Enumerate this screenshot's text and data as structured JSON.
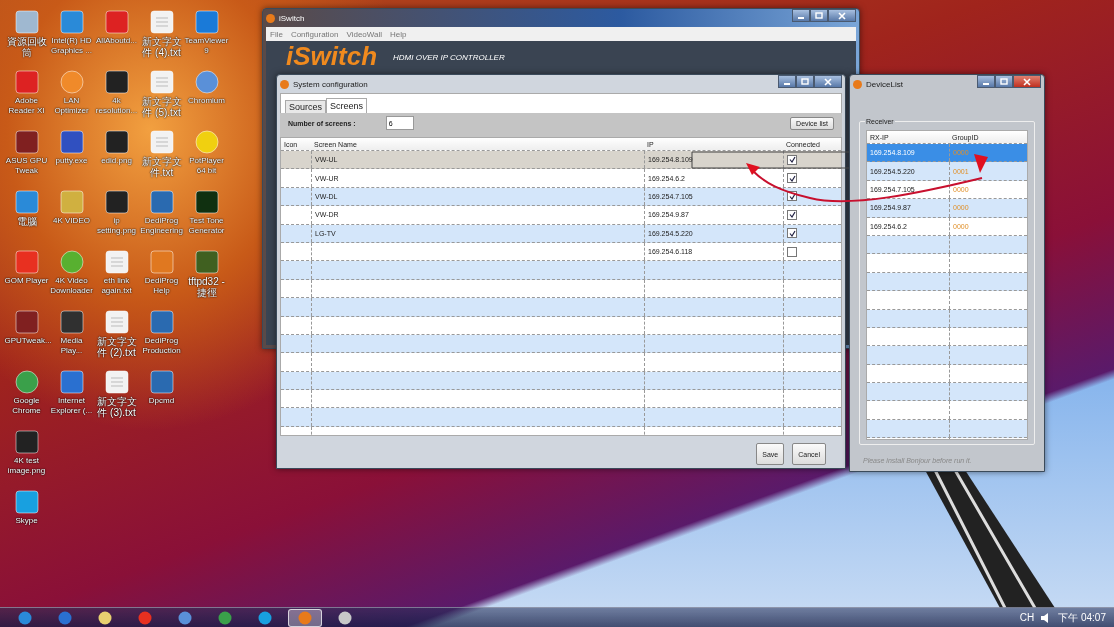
{
  "desktop": {
    "rows": [
      [
        {
          "label": "資源回收筒",
          "kind": "bin"
        },
        {
          "label": "Intel(R) HD Graphics ...",
          "kind": "monitor"
        },
        {
          "label": "AllAboutd...",
          "kind": "pdf"
        },
        {
          "label": "新文字文件 (4).txt",
          "kind": "doc"
        },
        {
          "label": "TeamViewer 9",
          "kind": "teamviewer"
        }
      ],
      [
        {
          "label": "Adobe Reader XI",
          "kind": "pdf"
        },
        {
          "label": "LAN Optimizer",
          "kind": "ring"
        },
        {
          "label": "4k resolution...",
          "kind": "image"
        },
        {
          "label": "新文字文件 (5).txt",
          "kind": "doc"
        },
        {
          "label": "Chromium",
          "kind": "chromium"
        }
      ],
      [
        {
          "label": "ASUS GPU Tweak",
          "kind": "gpu"
        },
        {
          "label": "putty.exe",
          "kind": "putty"
        },
        {
          "label": "edid.png",
          "kind": "image"
        },
        {
          "label": "新文字文件.txt",
          "kind": "doc"
        },
        {
          "label": "PotPlayer 64 bit",
          "kind": "player"
        }
      ],
      [
        {
          "label": "電腦",
          "kind": "monitor"
        },
        {
          "label": "4K VIDEO",
          "kind": "folder"
        },
        {
          "label": "ip setting.png",
          "kind": "image"
        },
        {
          "label": "DediProg Engineering",
          "kind": "dediprog"
        },
        {
          "label": "Test Tone Generator",
          "kind": "wave"
        }
      ],
      [
        {
          "label": "GOM Player",
          "kind": "gom"
        },
        {
          "label": "4K Video Downloader",
          "kind": "download"
        },
        {
          "label": "eth link again.txt",
          "kind": "doc"
        },
        {
          "label": "DediProg Help",
          "kind": "help"
        },
        {
          "label": "tftpd32 - 捷徑",
          "kind": "tftp"
        }
      ],
      [
        {
          "label": "GPUTweak...",
          "kind": "gpu"
        },
        {
          "label": "Media Play...",
          "kind": "media"
        },
        {
          "label": "新文字文件 (2).txt",
          "kind": "doc"
        },
        {
          "label": "DediProg Production",
          "kind": "dediprog"
        }
      ],
      [
        {
          "label": "Google Chrome",
          "kind": "chrome"
        },
        {
          "label": "Internet Explorer (...",
          "kind": "ie"
        },
        {
          "label": "新文字文件 (3).txt",
          "kind": "doc"
        },
        {
          "label": "Dpcmd",
          "kind": "dediprog"
        }
      ],
      [
        {
          "label": "4K test image.png",
          "kind": "image"
        }
      ],
      [
        {
          "label": "Skype",
          "kind": "skype"
        }
      ]
    ]
  },
  "main_window": {
    "title": "iSwitch",
    "menu": [
      "File",
      "Configuration",
      "VideoWall",
      "Help"
    ],
    "logo": "iSwitch",
    "subtitle": "HDMI OVER IP CONTROLLER"
  },
  "config_window": {
    "title": "System configuration",
    "tabs": [
      {
        "label": "Sources",
        "selected": false
      },
      {
        "label": "Screens",
        "selected": true
      }
    ],
    "screens_label": "Number of screens :",
    "screens_value": "6",
    "device_list_button": "Device list",
    "columns": [
      "Icon",
      "Screen Name",
      "IP",
      "Connected"
    ],
    "rows": [
      {
        "name": "VW-UL",
        "ip": "169.254.8.109",
        "checked": true,
        "selected": true
      },
      {
        "name": "VW-UR",
        "ip": "169.254.6.2",
        "checked": true,
        "selected": false
      },
      {
        "name": "VW-DL",
        "ip": "169.254.7.105",
        "checked": true,
        "selected": false
      },
      {
        "name": "VW-DR",
        "ip": "169.254.9.87",
        "checked": true,
        "selected": false
      },
      {
        "name": "LG-TV",
        "ip": "169.254.5.220",
        "checked": true,
        "selected": false
      },
      {
        "ip": "169.254.6.118",
        "checked": false,
        "selected": false
      }
    ],
    "buttons": [
      "Save",
      "Cancel"
    ]
  },
  "device_window": {
    "title": "DeviceList",
    "group": "Receiver",
    "columns": [
      "RX-IP",
      "GroupID"
    ],
    "rows": [
      {
        "ip": "169.254.8.109",
        "group": "0000",
        "selected": true
      },
      {
        "ip": "169.254.5.220",
        "group": "0001",
        "selected": false
      },
      {
        "ip": "169.254.7.105",
        "group": "0000",
        "selected": false
      },
      {
        "ip": "169.254.9.87",
        "group": "0000",
        "selected": false
      },
      {
        "ip": "169.254.6.2",
        "group": "0000",
        "selected": false
      }
    ],
    "footer": "Please install Bonjour before run it."
  },
  "taskbar": {
    "apps": [
      {
        "kind": "start",
        "active": false
      },
      {
        "kind": "ie",
        "active": false
      },
      {
        "kind": "notes",
        "active": false
      },
      {
        "kind": "gom",
        "active": false
      },
      {
        "kind": "chromium",
        "active": false
      },
      {
        "kind": "chrome",
        "active": false
      },
      {
        "kind": "skype",
        "active": false
      },
      {
        "kind": "iswitch",
        "active": true
      },
      {
        "kind": "paint",
        "active": false
      }
    ],
    "language": "CH",
    "time": "下午 04:07"
  }
}
